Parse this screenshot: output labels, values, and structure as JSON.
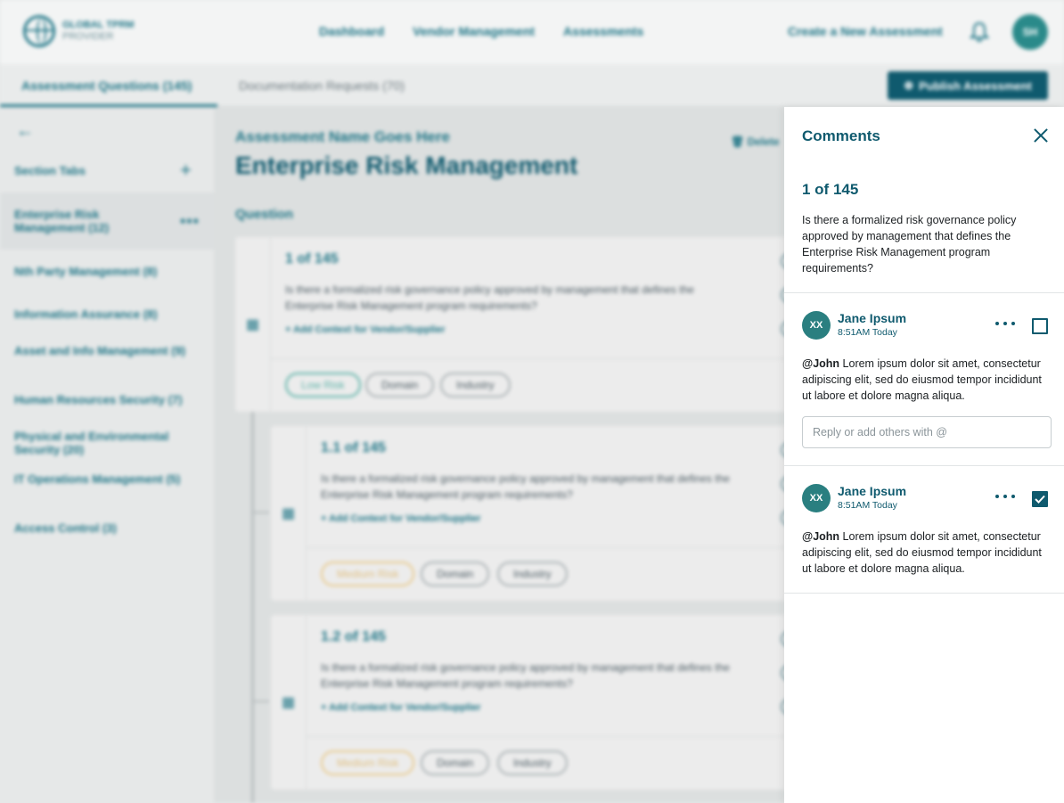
{
  "header": {
    "logo_line1": "GLOBAL TPRM",
    "logo_line2": "PROVIDER",
    "nav": [
      "Dashboard",
      "Vendor Management",
      "Assessments"
    ],
    "create_label": "Create a New Assessment",
    "user_initials": "SH"
  },
  "tabs": {
    "questions": "Assessment Questions (145)",
    "documentation": "Documentation Requests (70)",
    "publish_label": "Publish Assessment"
  },
  "sidebar": {
    "heading": "Section Tabs",
    "items": [
      "Enterprise Risk Management (12)",
      "Nth Party Management (8)",
      "Information Assurance (8)",
      "Asset and Info Management (9)",
      "Human Resources Security (7)",
      "Physical and Environmental Security (20)",
      "IT Operations Management (5)",
      "Access Control (3)"
    ]
  },
  "main": {
    "assessment_name": "Assessment Name Goes Here",
    "title": "Enterprise Risk Management",
    "delete_label": "Delete",
    "question_label": "Question",
    "questions": [
      {
        "num": "1 of 145",
        "text": "Is there a formalized risk governance policy approved by management that defines the Enterprise Risk Management program requirements?",
        "link": "+ Add Context for Vendor/Supplier",
        "risk": "Low Risk",
        "tags": [
          "Domain",
          "Industry"
        ]
      },
      {
        "num": "1.1 of 145",
        "text": "Is there a formalized risk governance policy approved by management that defines the Enterprise Risk Management program requirements?",
        "link": "+ Add Context for Vendor/Supplier",
        "risk": "Medium Risk",
        "tags": [
          "Domain",
          "Industry"
        ]
      },
      {
        "num": "1.2 of 145",
        "text": "Is there a formalized risk governance policy approved by management that defines the Enterprise Risk Management program requirements?",
        "link": "+ Add Context for Vendor/Supplier",
        "risk": "Medium Risk",
        "tags": [
          "Domain",
          "Industry"
        ]
      }
    ]
  },
  "comments_panel": {
    "title": "Comments",
    "question_num": "1 of 145",
    "question_text": "Is there a formalized risk governance policy approved by management that defines the Enterprise Risk Management program requirements?",
    "comments": [
      {
        "initials": "XX",
        "author": "Jane Ipsum",
        "time": "8:51AM Today",
        "mention": "@John",
        "body": " Lorem ipsum dolor sit amet, consectetur adipiscing elit, sed do eiusmod tempor incididunt ut labore et dolore magna aliqua.",
        "resolved": false
      },
      {
        "initials": "XX",
        "author": "Jane Ipsum",
        "time": "8:51AM Today",
        "mention": "@John",
        "body": " Lorem ipsum dolor sit amet, consectetur adipiscing elit, sed do eiusmod tempor incididunt ut labore et dolore magna aliqua.",
        "resolved": true
      }
    ],
    "reply_placeholder": "Reply or add others with @"
  },
  "colors": {
    "brand": "#0f5a6e",
    "accent": "#1e7586",
    "avatar": "#2a7f80",
    "low_risk": "#59b1a6",
    "medium_risk": "#e9c98a"
  }
}
